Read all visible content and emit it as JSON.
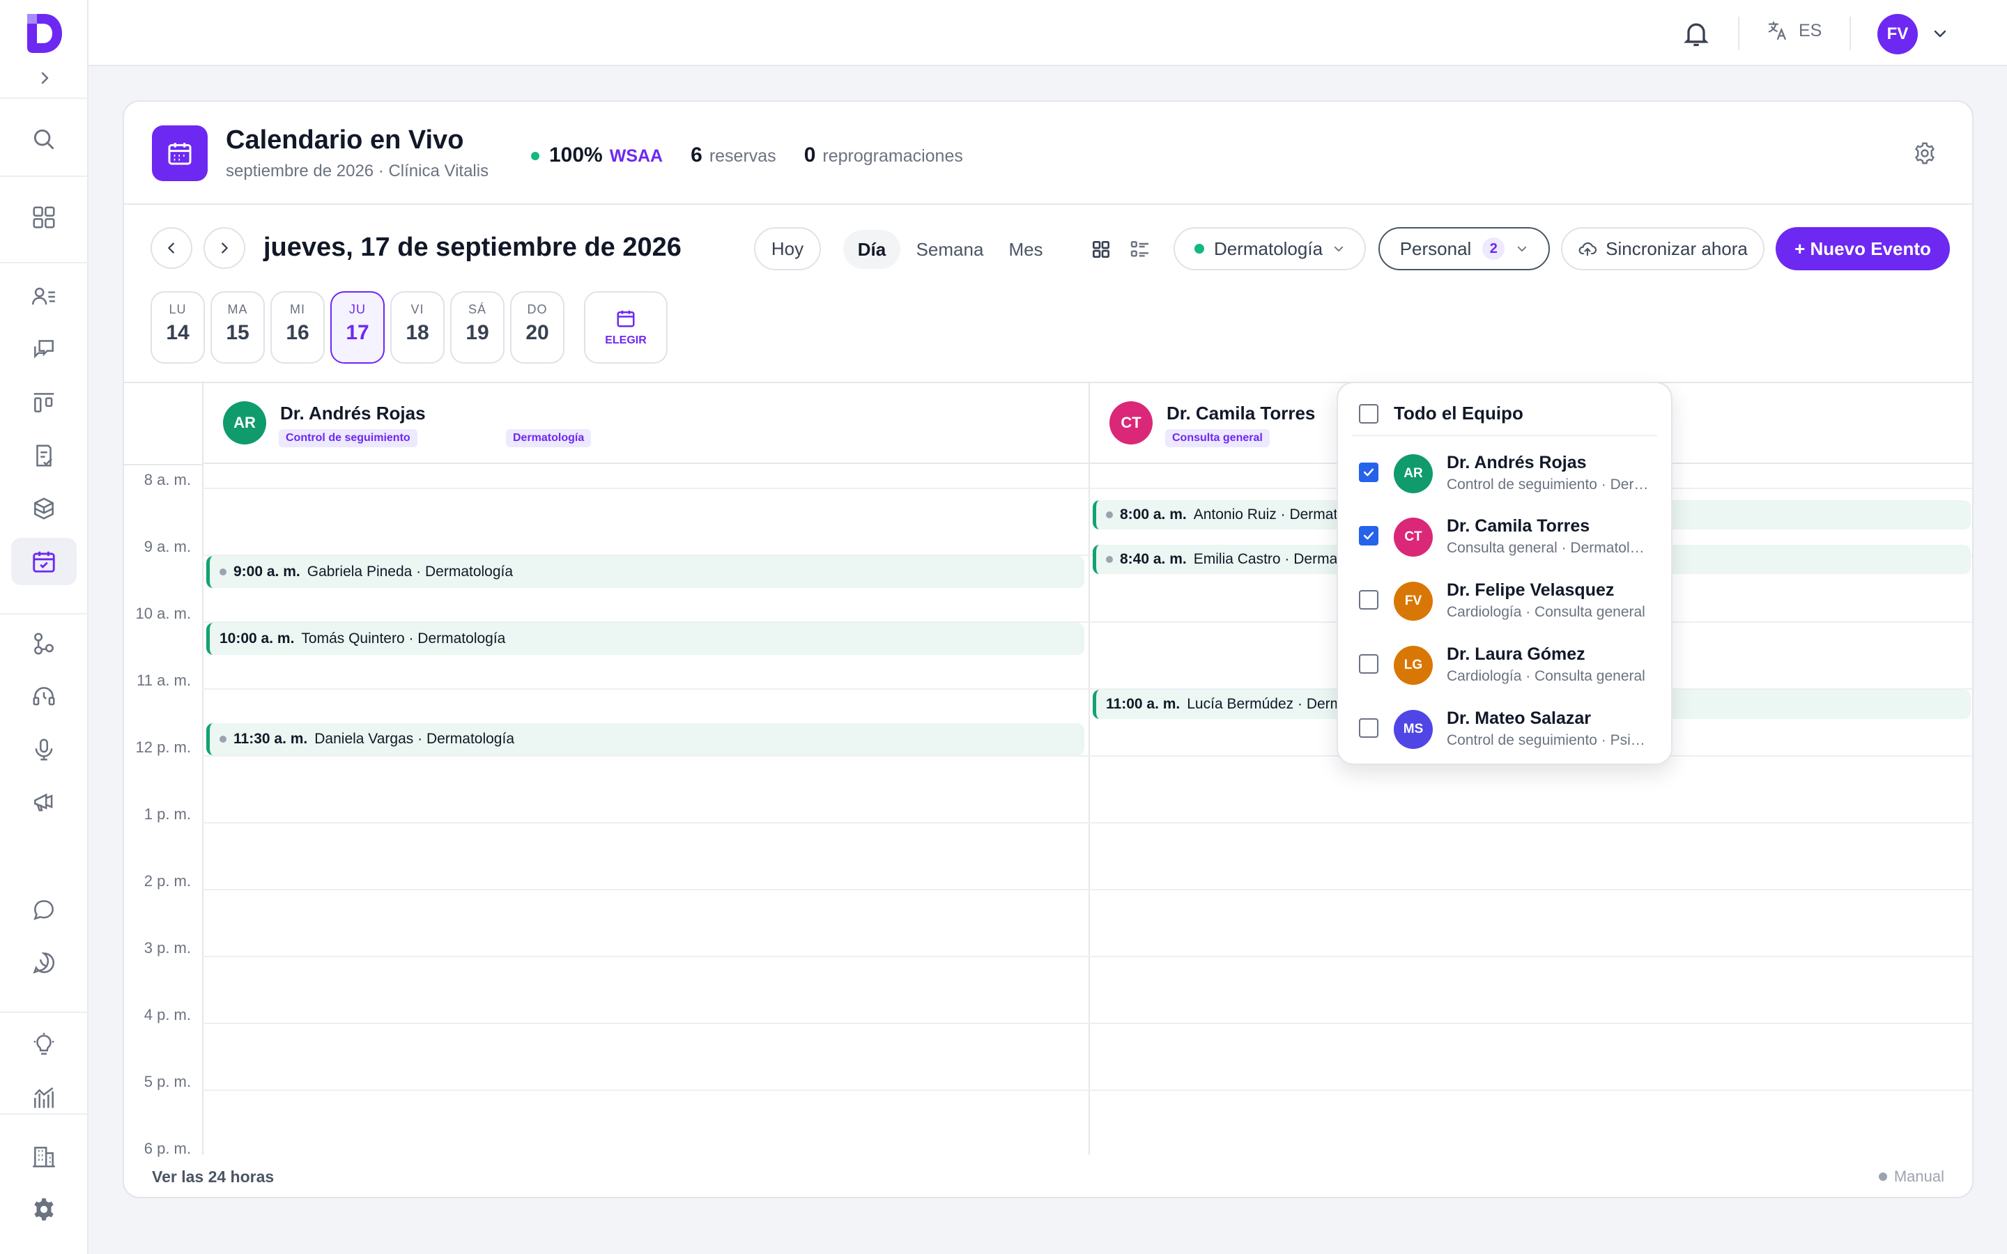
{
  "topbar": {
    "language": "ES",
    "user_initials": "FV"
  },
  "header": {
    "title": "Calendario en Vivo",
    "subtitle": "septiembre de 2026 · Clínica Vitalis",
    "stat_percent": "100%",
    "stat_source": "WSAA",
    "bookings_count": "6",
    "bookings_label": "reservas",
    "reschedules_count": "0",
    "reschedules_label": "reprogramaciones"
  },
  "toolbar": {
    "date_title": "jueves, 17 de septiembre de 2026",
    "today_label": "Hoy",
    "views": [
      "Día",
      "Semana",
      "Mes"
    ],
    "active_view": "Día",
    "specialty_filter": "Dermatología",
    "staff_filter_label": "Personal",
    "staff_filter_count": "2",
    "sync_label": "Sincronizar ahora",
    "new_event_label": "+ Nuevo Evento"
  },
  "day_strip": {
    "days": [
      {
        "dow": "LU",
        "num": "14"
      },
      {
        "dow": "MA",
        "num": "15"
      },
      {
        "dow": "MI",
        "num": "16"
      },
      {
        "dow": "JU",
        "num": "17",
        "active": true
      },
      {
        "dow": "VI",
        "num": "18"
      },
      {
        "dow": "SÁ",
        "num": "19"
      },
      {
        "dow": "DO",
        "num": "20"
      }
    ],
    "choose_label": "ELEGIR"
  },
  "columns": [
    {
      "initials": "AR",
      "name": "Dr. Andrés Rojas",
      "color": "#0f9b6c",
      "tags": [
        "Control de seguimiento",
        "Dermatología"
      ],
      "events": [
        {
          "time": "9:00 a. m.",
          "text": "Gabriela Pineda · Dermatología",
          "dot": true
        },
        {
          "time": "10:00 a. m.",
          "text": "Tomás Quintero · Dermatología",
          "dot": false
        },
        {
          "time": "11:30 a. m.",
          "text": "Daniela Vargas · Dermatología",
          "dot": true
        }
      ]
    },
    {
      "initials": "CT",
      "name": "Dr. Camila Torres",
      "color": "#db2777",
      "tags": [
        "Consulta general"
      ],
      "events": [
        {
          "time": "8:00 a. m.",
          "text": "Antonio Ruiz · Dermatología",
          "dot": true
        },
        {
          "time": "8:40 a. m.",
          "text": "Emilia Castro · Dermatología",
          "dot": true
        },
        {
          "time": "11:00 a. m.",
          "text": "Lucía Bermúdez · Dermatología",
          "dot": false
        }
      ]
    }
  ],
  "hours": [
    "8 a. m.",
    "9 a. m.",
    "10 a. m.",
    "11 a. m.",
    "12 p. m.",
    "1 p. m.",
    "2 p. m.",
    "3 p. m.",
    "4 p. m.",
    "5 p. m.",
    "6 p. m."
  ],
  "footer": {
    "see_all": "Ver las 24 horas",
    "mode": "Manual"
  },
  "staff_dropdown": {
    "all_label": "Todo el Equipo",
    "items": [
      {
        "initials": "AR",
        "name": "Dr. Andrés Rojas",
        "sub": "Control de seguimiento · Dermatología",
        "checked": true,
        "color": "#0f9b6c"
      },
      {
        "initials": "CT",
        "name": "Dr. Camila Torres",
        "sub": "Consulta general · Dermatología",
        "checked": true,
        "color": "#db2777"
      },
      {
        "initials": "FV",
        "name": "Dr. Felipe Velasquez",
        "sub": "Cardiología · Consulta general",
        "checked": false,
        "color": "#d97706"
      },
      {
        "initials": "LG",
        "name": "Dr. Laura Gómez",
        "sub": "Cardiología · Consulta general",
        "checked": false,
        "color": "#d97706"
      },
      {
        "initials": "MS",
        "name": "Dr. Mateo Salazar",
        "sub": "Control de seguimiento · Psicología",
        "checked": false,
        "color": "#4f46e5"
      }
    ]
  }
}
